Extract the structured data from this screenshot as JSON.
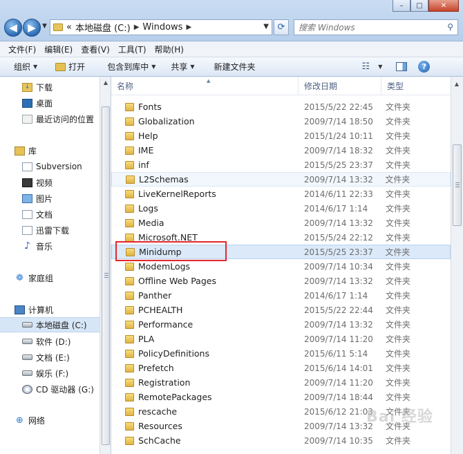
{
  "window": {
    "minimize_label": "–",
    "maximize_label": "□",
    "close_label": "✕"
  },
  "nav": {
    "back_label": "◀",
    "forward_label": "▶"
  },
  "address": {
    "overflow": "«",
    "segments": [
      "本地磁盘 (C:)",
      "Windows"
    ],
    "separator": "▶"
  },
  "search": {
    "placeholder": "搜索 Windows"
  },
  "menu": [
    "文件(F)",
    "编辑(E)",
    "查看(V)",
    "工具(T)",
    "帮助(H)"
  ],
  "toolbar": {
    "organize": "组织",
    "open": "打开",
    "include_in_library": "包含到库中",
    "share": "共享",
    "new_folder": "新建文件夹"
  },
  "navpane": {
    "items": [
      {
        "label": "下载",
        "icon": "download-folder-icon"
      },
      {
        "label": "桌面",
        "icon": "desktop-icon"
      },
      {
        "label": "最近访问的位置",
        "icon": "recent-places-icon"
      },
      {
        "label": "库",
        "icon": "library-icon"
      },
      {
        "label": "Subversion",
        "icon": "document-library-icon"
      },
      {
        "label": "视频",
        "icon": "video-library-icon"
      },
      {
        "label": "图片",
        "icon": "pictures-library-icon"
      },
      {
        "label": "文档",
        "icon": "documents-library-icon"
      },
      {
        "label": "迅雷下载",
        "icon": "thunder-download-library-icon"
      },
      {
        "label": "音乐",
        "icon": "music-library-icon"
      },
      {
        "label": "家庭组",
        "icon": "homegroup-icon"
      },
      {
        "label": "计算机",
        "icon": "computer-icon"
      },
      {
        "label": "本地磁盘 (C:)",
        "icon": "system-drive-icon"
      },
      {
        "label": "软件 (D:)",
        "icon": "drive-icon"
      },
      {
        "label": "文档 (E:)",
        "icon": "drive-icon"
      },
      {
        "label": "娱乐 (F:)",
        "icon": "drive-icon"
      },
      {
        "label": "CD 驱动器 (G:)",
        "icon": "cd-drive-icon"
      },
      {
        "label": "网络",
        "icon": "network-icon"
      }
    ]
  },
  "columns": {
    "name": "名称",
    "modified": "修改日期",
    "type": "类型"
  },
  "files": [
    {
      "name": "Fonts",
      "date": "2015/5/22 22:45",
      "type": "文件夹"
    },
    {
      "name": "Globalization",
      "date": "2009/7/14 18:50",
      "type": "文件夹"
    },
    {
      "name": "Help",
      "date": "2015/1/24 10:11",
      "type": "文件夹"
    },
    {
      "name": "IME",
      "date": "2009/7/14 18:32",
      "type": "文件夹"
    },
    {
      "name": "inf",
      "date": "2015/5/25 23:37",
      "type": "文件夹"
    },
    {
      "name": "L2Schemas",
      "date": "2009/7/14 13:32",
      "type": "文件夹"
    },
    {
      "name": "LiveKernelReports",
      "date": "2014/6/11 22:33",
      "type": "文件夹"
    },
    {
      "name": "Logs",
      "date": "2014/6/17 1:14",
      "type": "文件夹"
    },
    {
      "name": "Media",
      "date": "2009/7/14 13:32",
      "type": "文件夹"
    },
    {
      "name": "Microsoft.NET",
      "date": "2015/5/24 22:12",
      "type": "文件夹"
    },
    {
      "name": "Minidump",
      "date": "2015/5/25 23:37",
      "type": "文件夹"
    },
    {
      "name": "ModemLogs",
      "date": "2009/7/14 10:34",
      "type": "文件夹"
    },
    {
      "name": "Offline Web Pages",
      "date": "2009/7/14 13:32",
      "type": "文件夹"
    },
    {
      "name": "Panther",
      "date": "2014/6/17 1:14",
      "type": "文件夹"
    },
    {
      "name": "PCHEALTH",
      "date": "2015/5/22 22:44",
      "type": "文件夹"
    },
    {
      "name": "Performance",
      "date": "2009/7/14 13:32",
      "type": "文件夹"
    },
    {
      "name": "PLA",
      "date": "2009/7/14 11:20",
      "type": "文件夹"
    },
    {
      "name": "PolicyDefinitions",
      "date": "2015/6/11 5:14",
      "type": "文件夹"
    },
    {
      "name": "Prefetch",
      "date": "2015/6/14 14:01",
      "type": "文件夹"
    },
    {
      "name": "Registration",
      "date": "2009/7/14 11:20",
      "type": "文件夹"
    },
    {
      "name": "RemotePackages",
      "date": "2009/7/14 18:44",
      "type": "文件夹"
    },
    {
      "name": "rescache",
      "date": "2015/6/12 21:03",
      "type": "文件夹"
    },
    {
      "name": "Resources",
      "date": "2009/7/14 13:32",
      "type": "文件夹"
    },
    {
      "name": "SchCache",
      "date": "2009/7/14 10:35",
      "type": "文件夹"
    }
  ],
  "watermark": "Bai 经验"
}
